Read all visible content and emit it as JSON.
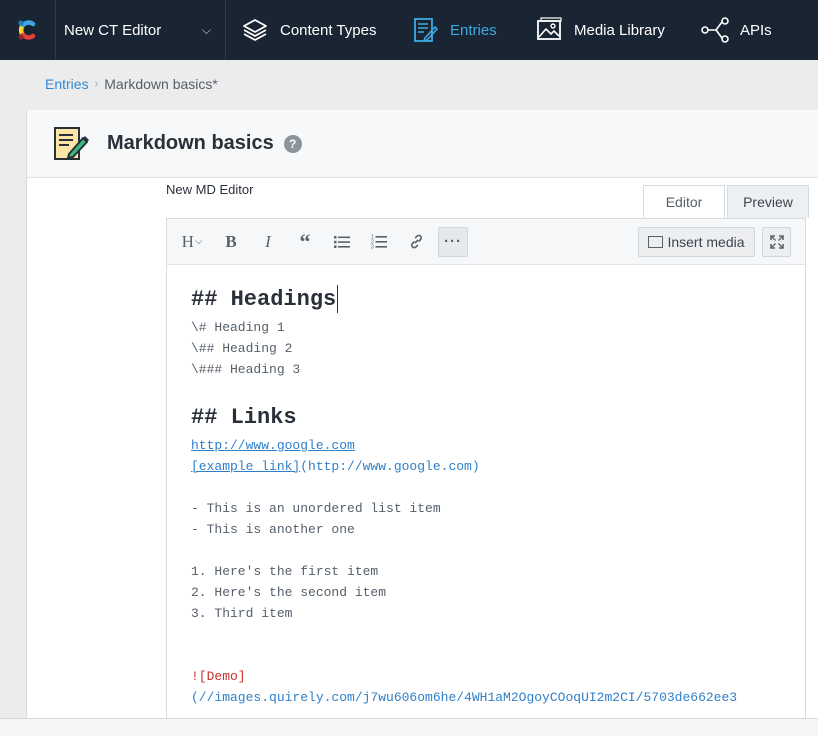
{
  "nav": {
    "space_name": "New CT Editor",
    "items": [
      {
        "label": "Content Types",
        "icon": "layers-icon"
      },
      {
        "label": "Entries",
        "icon": "entries-icon",
        "active": true
      },
      {
        "label": "Media Library",
        "icon": "image-icon"
      },
      {
        "label": "APIs",
        "icon": "api-icon"
      }
    ],
    "accent": "#3fa9e4",
    "bg": "#192532"
  },
  "breadcrumb": {
    "root": "Entries",
    "current": "Markdown basics*"
  },
  "entry": {
    "title": "Markdown basics",
    "help": "?"
  },
  "field": {
    "label": "New MD Editor"
  },
  "tabs": {
    "editor": "Editor",
    "preview": "Preview"
  },
  "toolbar": {
    "heading": "H",
    "bold": "B",
    "italic": "I",
    "more": "···",
    "insert_media": "Insert media"
  },
  "markdown": {
    "h_headings": "## Headings",
    "l1": "\\# Heading 1",
    "l2": "\\## Heading 2",
    "l3": "\\### Heading 3",
    "h_links": "## Links",
    "url1": "http://www.google.com",
    "link_text": "[example link]",
    "link_url": "(http://www.google.com)",
    "ul1": "- This is an unordered list item",
    "ul2": "- This is another one",
    "ol1": "1. Here's the first item",
    "ol2": "2. Here's the second item",
    "ol3": "3. Third item",
    "img_alt": "![Demo]",
    "img_url": "(//images.quirely.com/j7wu606om6he/4WH1aM2OgoyCOoqUI2m2CI/5703de662ee3"
  }
}
